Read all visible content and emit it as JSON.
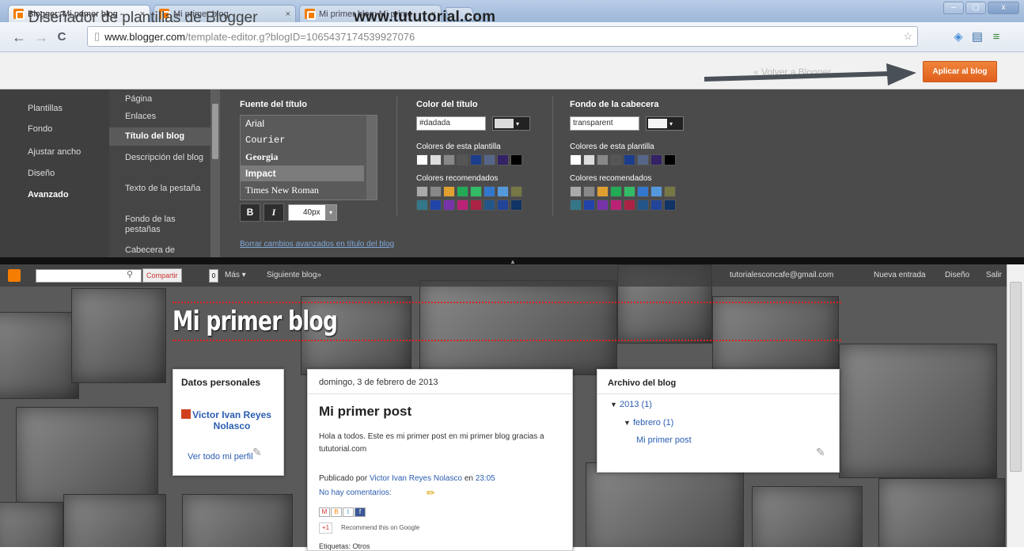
{
  "browser": {
    "tabs": [
      {
        "title": "Blogger: Mi primer blog -",
        "close": "×"
      },
      {
        "title": "Mi primer blog",
        "close": "×"
      },
      {
        "title": "Mi primer blog: Mi prime",
        "close": "×"
      }
    ],
    "url_host": "www.blogger.com",
    "url_path": "/template-editor.g?blogID=1065437174539927076",
    "nav_back": "←",
    "nav_forward": "→",
    "nav_reload": "C",
    "window_min": "–",
    "window_max": "▢",
    "window_close": "x"
  },
  "designer": {
    "title": "Diseñador de plantillas de Blogger",
    "watermark": "www.tututorial.com",
    "hidden_link": "« Volver a Blogger",
    "apply_button": "Aplicar al blog"
  },
  "left_nav": [
    "Plantillas",
    "Fondo",
    "Ajustar ancho",
    "Diseño",
    "Avanzado"
  ],
  "sub_nav": [
    "Página",
    "Enlaces",
    "Título del blog",
    "Descripción del blog",
    "Texto de la pestaña",
    "Fondo de las pestañas",
    "Cabecera de"
  ],
  "title_font": {
    "heading": "Fuente del título",
    "fonts": [
      "Arial",
      "Courier",
      "Georgia",
      "Impact",
      "Times New Roman"
    ],
    "selected": "Impact",
    "bold": "B",
    "italic": "I",
    "size": "40px"
  },
  "title_color": {
    "heading": "Color del título",
    "value": "#dadada",
    "template_colors_label": "Colores de esta plantilla",
    "recommended_label": "Colores recomendados"
  },
  "header_bg": {
    "heading": "Fondo de la cabecera",
    "value": "transparent",
    "template_colors_label": "Colores de esta plantilla",
    "recommended_label": "Colores recomendados"
  },
  "template_swatches": [
    "#ffffff",
    "#dddddd",
    "#888888",
    "#555555",
    "#1c3d8c",
    "#556688",
    "#332266",
    "#000000"
  ],
  "recommended_swatches_row1": [
    "#aaaaaa",
    "#888888",
    "#e0a030",
    "#22aa55",
    "#33bb66",
    "#3377cc",
    "#5599dd",
    "#777744"
  ],
  "recommended_swatches_row2": [
    "#337788",
    "#2244aa",
    "#7733aa",
    "#bb2277",
    "#aa2244",
    "#225588",
    "#224499",
    "#113366"
  ],
  "reset_link": "Borrar cambios avanzados en título del blog",
  "blog_navbar": {
    "share": "Compartir",
    "more": "Más ▾",
    "follow": "Siguiente blog»",
    "email": "tutorialesconcafe@gmail.com",
    "new_post": "Nueva entrada",
    "design": "Diseño",
    "exit": "Salir"
  },
  "blog": {
    "title": "Mi primer blog",
    "profile": {
      "heading": "Datos personales",
      "name": "Victor Ivan Reyes Nolasco",
      "view_profile": "Ver todo mi perfil"
    },
    "post": {
      "date": "domingo, 3 de febrero de 2013",
      "title": "Mi primer post",
      "body": "Hola a todos. Este es mi primer post en mi primer blog gracias a tututorial.com",
      "published_by": "Publicado por",
      "author": "Victor Ivan Reyes Nolasco",
      "at": "en",
      "time": "23:05",
      "comments": "No hay comentarios:",
      "recommend": "Recommend this on Google",
      "plus": "+1",
      "labels": "Etiquetas: Otros"
    },
    "archive": {
      "heading": "Archivo del blog",
      "year": "2013",
      "year_count": "(1)",
      "month": "febrero",
      "month_count": "(1)",
      "post": "Mi primer post"
    }
  }
}
